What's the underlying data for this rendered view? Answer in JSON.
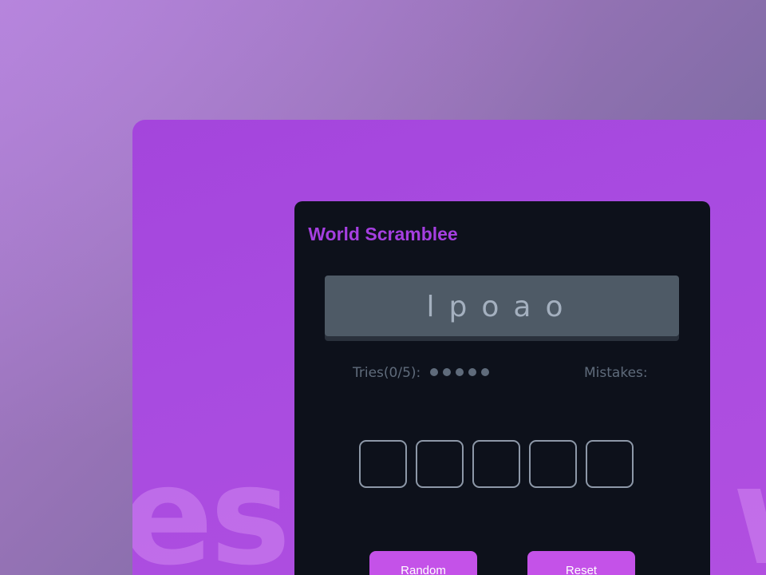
{
  "game": {
    "title": "World Scramblee",
    "scrambled_word": "lpoao",
    "tries_label": "Tries(0/5):",
    "tries_used": 0,
    "tries_max": 5,
    "mistakes_label": "Mistakes:",
    "slots_count": 5,
    "buttons": {
      "random_label": "Random",
      "reset_label": "Reset"
    }
  },
  "background": {
    "left_word": "ess",
    "right_word": "w"
  },
  "colors": {
    "title": "#a53fe0",
    "accent_button": "#c452e8",
    "panel": "#0d111b",
    "card": "#a84be0"
  }
}
